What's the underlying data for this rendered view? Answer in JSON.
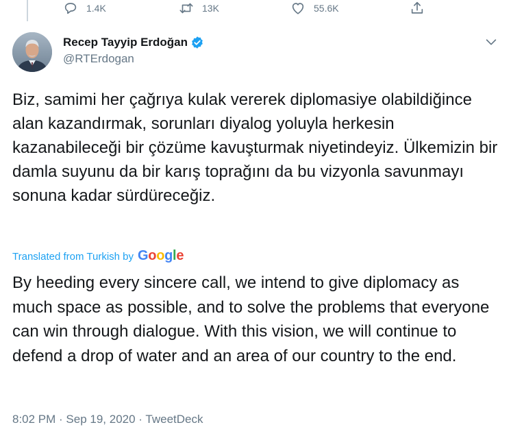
{
  "actions": {
    "reply_count": "1.4K",
    "retweet_count": "13K",
    "like_count": "55.6K"
  },
  "author": {
    "display_name": "Recep Tayyip Erdoğan",
    "handle": "@RTErdogan",
    "verified": true
  },
  "tweet": {
    "text": "Biz, samimi her çağrıya kulak vererek diplomasiye olabildiğince alan kazandırmak, sorunları diyalog yoluyla herkesin kazanabileceği bir çözüme kavuşturmak niyetindeyiz. Ülkemizin bir damla suyunu da bir karış toprağını da bu vizyonla savunmayı sonuna kadar sürdüreceğiz.",
    "translated_label": "Translated from Turkish by",
    "translation_provider": "Google",
    "translation": "By heeding every sincere call, we intend to give diplomacy as much space as possible, and to solve the problems that everyone can win through dialogue. With this vision, we will continue to defend a drop of water and an area of our country to the end."
  },
  "meta": {
    "time": "8:02 PM",
    "separator": " · ",
    "date": "Sep 19, 2020",
    "source": "TweetDeck"
  },
  "colors": {
    "accent": "#1da1f2",
    "secondary_text": "#657786",
    "primary_text": "#14171a"
  }
}
